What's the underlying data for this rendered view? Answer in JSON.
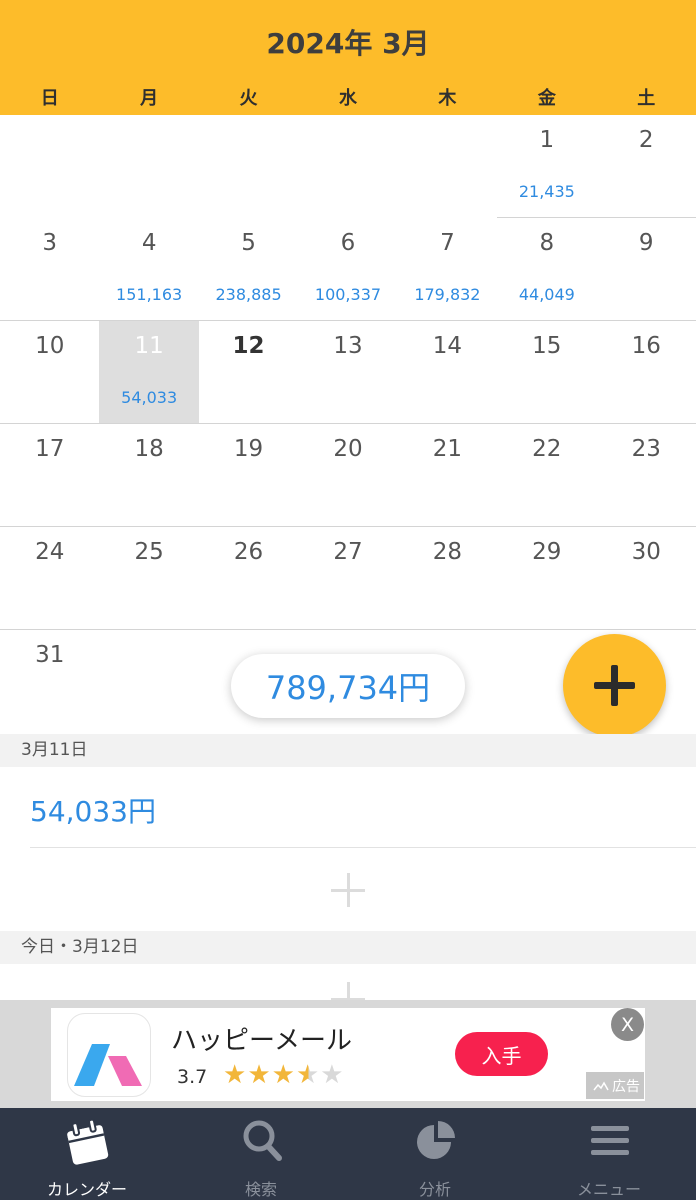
{
  "header": {
    "title": "2024年 3月"
  },
  "weekdays": [
    "日",
    "月",
    "火",
    "水",
    "木",
    "金",
    "土"
  ],
  "calendar": {
    "weeks": [
      [
        {
          "day": ""
        },
        {
          "day": ""
        },
        {
          "day": ""
        },
        {
          "day": ""
        },
        {
          "day": ""
        },
        {
          "day": "1",
          "amount": "21,435"
        },
        {
          "day": "2"
        }
      ],
      [
        {
          "day": "3"
        },
        {
          "day": "4",
          "amount": "151,163"
        },
        {
          "day": "5",
          "amount": "238,885"
        },
        {
          "day": "6",
          "amount": "100,337"
        },
        {
          "day": "7",
          "amount": "179,832"
        },
        {
          "day": "8",
          "amount": "44,049"
        },
        {
          "day": "9"
        }
      ],
      [
        {
          "day": "10"
        },
        {
          "day": "11",
          "amount": "54,033",
          "selected": true
        },
        {
          "day": "12",
          "today": true
        },
        {
          "day": "13"
        },
        {
          "day": "14"
        },
        {
          "day": "15"
        },
        {
          "day": "16"
        }
      ],
      [
        {
          "day": "17"
        },
        {
          "day": "18"
        },
        {
          "day": "19"
        },
        {
          "day": "20"
        },
        {
          "day": "21"
        },
        {
          "day": "22"
        },
        {
          "day": "23"
        }
      ],
      [
        {
          "day": "24"
        },
        {
          "day": "25"
        },
        {
          "day": "26"
        },
        {
          "day": "27"
        },
        {
          "day": "28"
        },
        {
          "day": "29"
        },
        {
          "day": "30"
        }
      ],
      [
        {
          "day": "31"
        },
        {
          "day": ""
        },
        {
          "day": ""
        },
        {
          "day": ""
        },
        {
          "day": ""
        },
        {
          "day": ""
        },
        {
          "day": ""
        }
      ]
    ]
  },
  "total": {
    "amount": "789,734円"
  },
  "selected_section": {
    "header": "3月11日",
    "amount": "54,033円"
  },
  "today_section": {
    "header": "今日・3月12日"
  },
  "ad": {
    "name": "ハッピーメール",
    "rating": "3.7",
    "stars": 3.7,
    "get_label": "入手",
    "close_label": "X",
    "badge_label": "広告"
  },
  "tabs": [
    {
      "label": "カレンダー",
      "icon": "calendar-icon",
      "active": true
    },
    {
      "label": "検索",
      "icon": "search-icon",
      "active": false
    },
    {
      "label": "分析",
      "icon": "pie-chart-icon",
      "active": false
    },
    {
      "label": "メニュー",
      "icon": "menu-icon",
      "active": false
    }
  ],
  "colors": {
    "accent": "#fdbc2a",
    "amount": "#2f8be0",
    "tabbar": "#2f3747",
    "ad_button": "#f7214e"
  }
}
